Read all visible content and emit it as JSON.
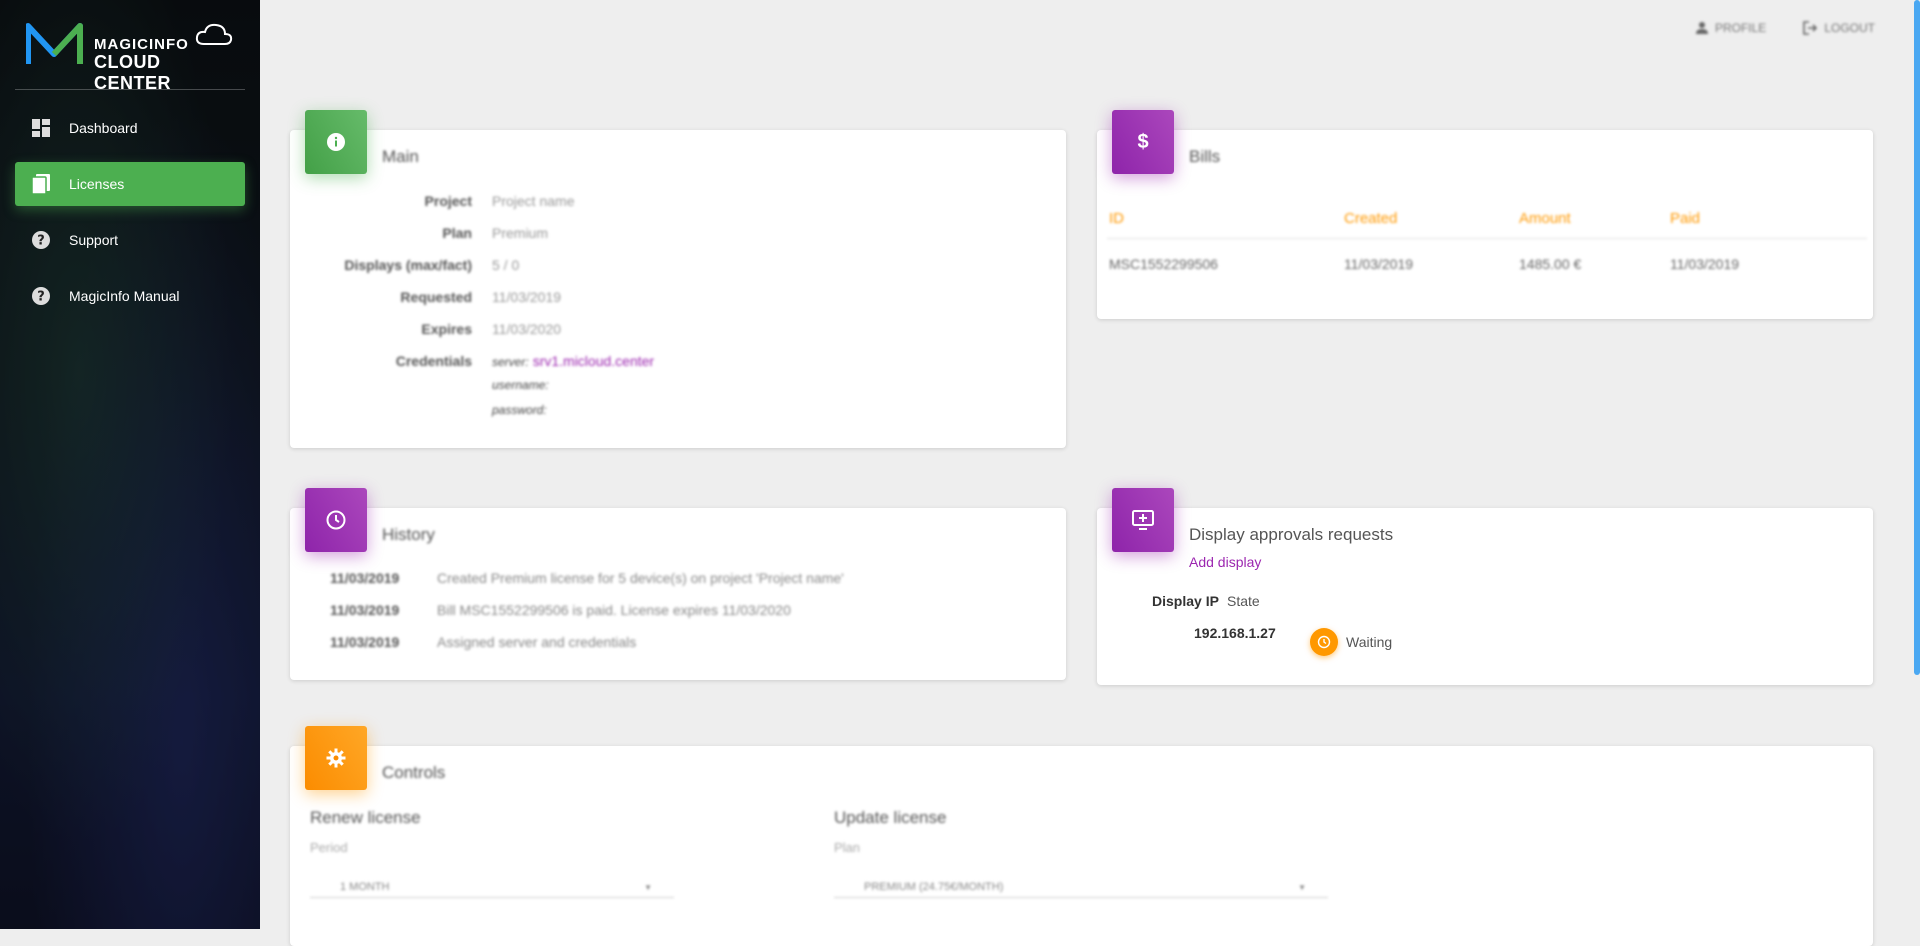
{
  "brand": {
    "line1": "MAGICINFO",
    "line2": "CLOUD CENTER",
    "colors": {
      "green": "#4caf50",
      "purple": "#9c27b0",
      "orange": "#ff9800",
      "blue": "#2196f3"
    }
  },
  "sidebar": {
    "items": [
      {
        "label": "Dashboard",
        "icon": "dashboard-icon",
        "active": false
      },
      {
        "label": "Licenses",
        "icon": "licenses-icon",
        "active": true
      },
      {
        "label": "Support",
        "icon": "help-icon",
        "active": false
      },
      {
        "label": "MagicInfo Manual",
        "icon": "help-icon",
        "active": false
      }
    ]
  },
  "topbar": {
    "profile_label": "PROFILE",
    "logout_label": "LOGOUT"
  },
  "main": {
    "title": "Main",
    "rows": [
      {
        "key": "Project",
        "value": "Project name"
      },
      {
        "key": "Plan",
        "value": "Premium"
      },
      {
        "key": "Displays (max/fact)",
        "value": "5 / 0"
      },
      {
        "key": "Requested",
        "value": "11/03/2019"
      },
      {
        "key": "Expires",
        "value": "11/03/2020"
      }
    ],
    "credentials_key": "Credentials",
    "server_label": "server:",
    "server_value": "srv1.micloud.center",
    "username_label": "username:",
    "password_label": "password:"
  },
  "bills": {
    "title": "Bills",
    "headers": [
      "ID",
      "Created",
      "Amount",
      "Paid"
    ],
    "rows": [
      [
        "MSC1552299506",
        "11/03/2019",
        "1485.00 €",
        "11/03/2019"
      ]
    ]
  },
  "history": {
    "title": "History",
    "rows": [
      {
        "date": "11/03/2019",
        "text": "Created Premium license for 5 device(s) on project 'Project name'"
      },
      {
        "date": "11/03/2019",
        "text": "Bill MSC1552299506 is paid. License expires 11/03/2020"
      },
      {
        "date": "11/03/2019",
        "text": "Assigned server and credentials"
      }
    ]
  },
  "approvals": {
    "title": "Display approvals requests",
    "add_label": "Add display",
    "col_ip": "Display IP",
    "col_state": "State",
    "ip": "192.168.1.27",
    "state": "Waiting"
  },
  "controls": {
    "title": "Controls",
    "renew_title": "Renew license",
    "renew_sub": "Period",
    "renew_value": "1 MONTH",
    "update_title": "Update license",
    "update_sub": "Plan",
    "update_value": "PREMIUM (24.75€/MONTH)"
  }
}
